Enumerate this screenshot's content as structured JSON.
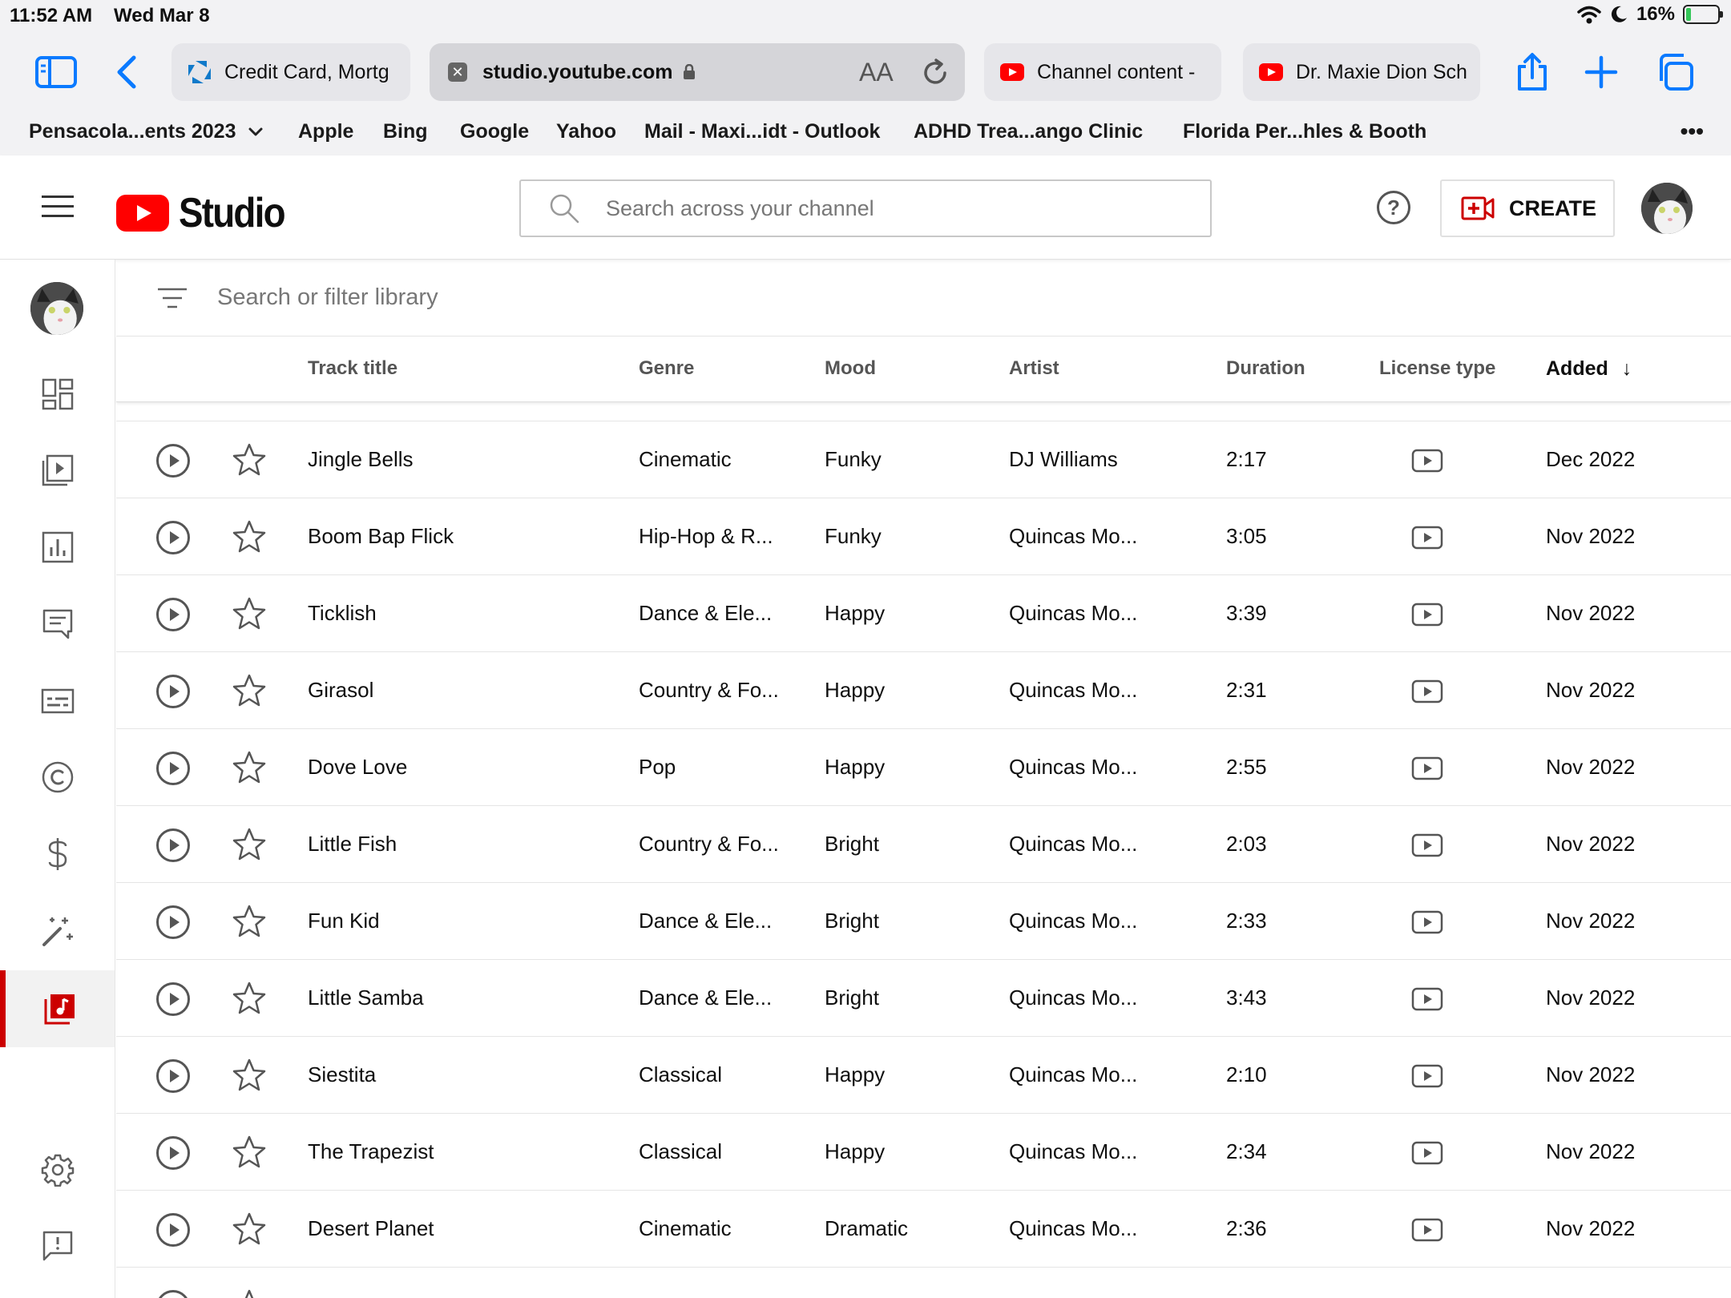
{
  "status_bar": {
    "time": "11:52 AM",
    "date": "Wed Mar 8",
    "battery": "16%",
    "battery_level": 0.16,
    "icons": [
      "wifi-icon",
      "moon-icon",
      "battery-charging-icon"
    ]
  },
  "safari": {
    "tabs": [
      {
        "title": "Credit Card, Mortg",
        "favicon": "chase-icon"
      },
      {
        "title": "studio.youtube.com",
        "favicon": "close-tab-icon",
        "active": true,
        "reader_label": "AA"
      },
      {
        "title": "Channel content -",
        "favicon": "youtube-icon"
      },
      {
        "title": "Dr. Maxie Dion Sch",
        "favicon": "youtube-icon"
      }
    ],
    "bookmarks": [
      "Pensacola...ents 2023",
      "Apple",
      "Bing",
      "Google",
      "Yahoo",
      "Mail - Maxi...idt - Outlook",
      "ADHD Trea...ango Clinic",
      "Florida Per...hles & Booth"
    ],
    "more_label": "•••"
  },
  "header": {
    "logo_text": "Studio",
    "search_placeholder": "Search across your channel",
    "help_label": "?",
    "create_label": "CREATE"
  },
  "nav": {
    "items": [
      "dashboard",
      "content",
      "analytics",
      "comments",
      "subtitles",
      "copyright",
      "earn",
      "customization",
      "audio-library"
    ],
    "active": "audio-library",
    "bottom": [
      "settings",
      "send-feedback"
    ]
  },
  "library": {
    "filter_placeholder": "Search or filter library",
    "columns": {
      "track_title": "Track title",
      "genre": "Genre",
      "mood": "Mood",
      "artist": "Artist",
      "duration": "Duration",
      "license_type": "License type",
      "added": "Added"
    },
    "sort_indicator": "↓",
    "rows": [
      {
        "title": "Jingle Bells",
        "genre": "Cinematic",
        "mood": "Funky",
        "artist": "DJ Williams",
        "duration": "2:17",
        "added": "Dec 2022"
      },
      {
        "title": "Boom Bap Flick",
        "genre": "Hip-Hop & R...",
        "mood": "Funky",
        "artist": "Quincas Mo...",
        "duration": "3:05",
        "added": "Nov 2022"
      },
      {
        "title": "Ticklish",
        "genre": "Dance & Ele...",
        "mood": "Happy",
        "artist": "Quincas Mo...",
        "duration": "3:39",
        "added": "Nov 2022"
      },
      {
        "title": "Girasol",
        "genre": "Country & Fo...",
        "mood": "Happy",
        "artist": "Quincas Mo...",
        "duration": "2:31",
        "added": "Nov 2022"
      },
      {
        "title": "Dove Love",
        "genre": "Pop",
        "mood": "Happy",
        "artist": "Quincas Mo...",
        "duration": "2:55",
        "added": "Nov 2022"
      },
      {
        "title": "Little Fish",
        "genre": "Country & Fo...",
        "mood": "Bright",
        "artist": "Quincas Mo...",
        "duration": "2:03",
        "added": "Nov 2022"
      },
      {
        "title": "Fun Kid",
        "genre": "Dance & Ele...",
        "mood": "Bright",
        "artist": "Quincas Mo...",
        "duration": "2:33",
        "added": "Nov 2022"
      },
      {
        "title": "Little Samba",
        "genre": "Dance & Ele...",
        "mood": "Bright",
        "artist": "Quincas Mo...",
        "duration": "3:43",
        "added": "Nov 2022"
      },
      {
        "title": "Siestita",
        "genre": "Classical",
        "mood": "Happy",
        "artist": "Quincas Mo...",
        "duration": "2:10",
        "added": "Nov 2022"
      },
      {
        "title": "The Trapezist",
        "genre": "Classical",
        "mood": "Happy",
        "artist": "Quincas Mo...",
        "duration": "2:34",
        "added": "Nov 2022"
      },
      {
        "title": "Desert Planet",
        "genre": "Cinematic",
        "mood": "Dramatic",
        "artist": "Quincas Mo...",
        "duration": "2:36",
        "added": "Nov 2022"
      }
    ]
  },
  "colors": {
    "brand_red": "#ff0000",
    "active_nav": "#cc0000",
    "charging_green": "#35c759",
    "safari_blue": "#0a7aff"
  }
}
